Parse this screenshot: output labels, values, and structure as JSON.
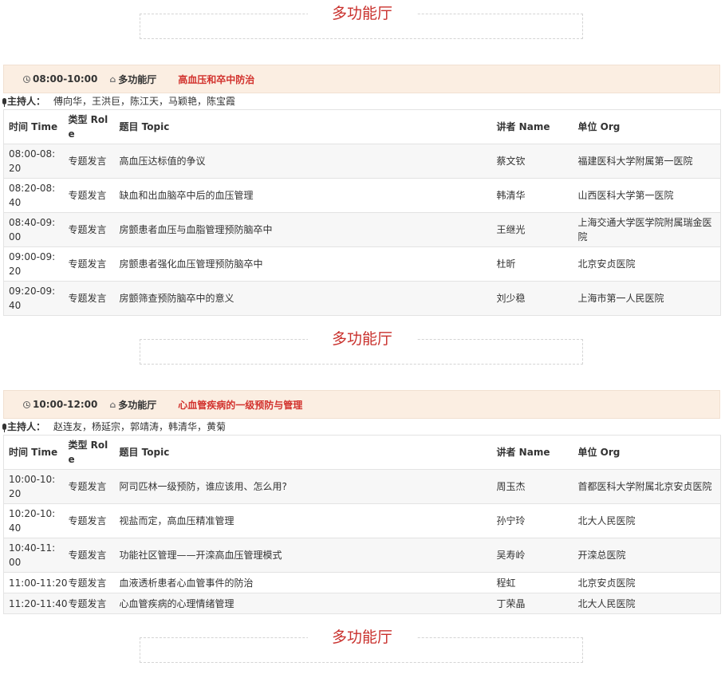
{
  "venue_title": "多功能厅",
  "headers": {
    "time": "时间 Time",
    "role": "类型 Role",
    "topic": "题目 Topic",
    "speaker": "讲者 Name",
    "org": "单位 Org"
  },
  "moderator_label": "主持人：",
  "sessions": [
    {
      "time": "08:00-10:00",
      "venue": "多功能厅",
      "topic": "高血压和卒中防治",
      "moderators": "傅向华，王洪巨，陈江天，马颖艳，陈宝霞",
      "rows": [
        {
          "time": "08:00-08:20",
          "role": "专题发言",
          "topic": "高血压达标值的争议",
          "speaker": "蔡文钦",
          "org": "福建医科大学附属第一医院"
        },
        {
          "time": "08:20-08:40",
          "role": "专题发言",
          "topic": "缺血和出血脑卒中后的血压管理",
          "speaker": "韩清华",
          "org": "山西医科大学第一医院"
        },
        {
          "time": "08:40-09:00",
          "role": "专题发言",
          "topic": "房颤患者血压与血脂管理预防脑卒中",
          "speaker": "王继光",
          "org": "上海交通大学医学院附属瑞金医院"
        },
        {
          "time": "09:00-09:20",
          "role": "专题发言",
          "topic": "房颤患者强化血压管理预防脑卒中",
          "speaker": "杜昕",
          "org": "北京安贞医院"
        },
        {
          "time": "09:20-09:40",
          "role": "专题发言",
          "topic": "房颤筛查预防脑卒中的意义",
          "speaker": "刘少稳",
          "org": "上海市第一人民医院"
        }
      ]
    },
    {
      "time": "10:00-12:00",
      "venue": "多功能厅",
      "topic": "心血管疾病的一级预防与管理",
      "moderators": "赵连友，杨延宗，郭靖涛，韩清华，黄菊",
      "rows": [
        {
          "time": "10:00-10:20",
          "role": "专题发言",
          "topic": "阿司匹林一级预防，谁应该用、怎么用?",
          "speaker": "周玉杰",
          "org": "首都医科大学附属北京安贞医院"
        },
        {
          "time": "10:20-10:40",
          "role": "专题发言",
          "topic": "视盐而定，高血压精准管理",
          "speaker": "孙宁玲",
          "org": "北大人民医院"
        },
        {
          "time": "10:40-11:00",
          "role": "专题发言",
          "topic": "功能社区管理——开滦高血压管理模式",
          "speaker": "吴寿岭",
          "org": "开滦总医院"
        },
        {
          "time": "11:00-11:20",
          "role": "专题发言",
          "topic": "血液透析患者心血管事件的防治",
          "speaker": "程虹",
          "org": "北京安贞医院"
        },
        {
          "time": "11:20-11:40",
          "role": "专题发言",
          "topic": "心血管疾病的心理情绪管理",
          "speaker": "丁荣晶",
          "org": "北大人民医院"
        }
      ]
    }
  ]
}
